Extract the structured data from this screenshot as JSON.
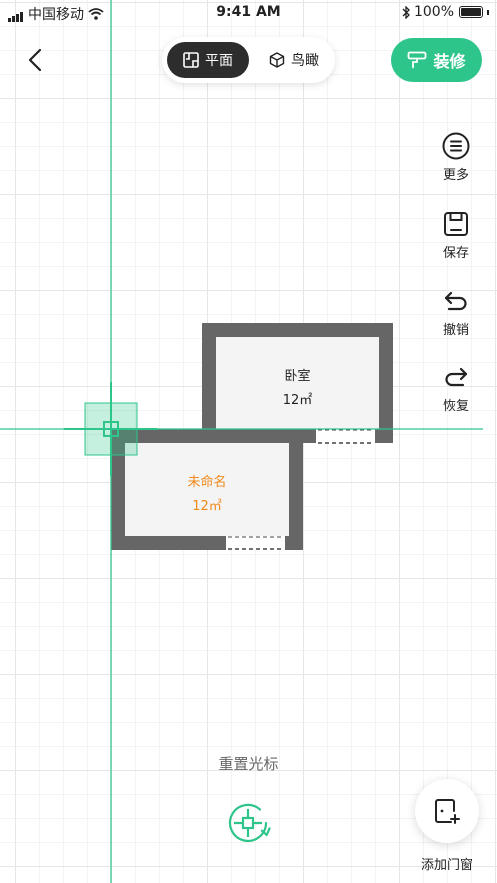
{
  "status_bar": {
    "carrier": "中国移动",
    "time": "9:41 AM",
    "battery": "100%"
  },
  "header": {
    "mode_plan_label": "平面",
    "mode_bird_label": "鸟瞰",
    "renovate_label": "装修",
    "active_mode": "平面"
  },
  "side_tools": {
    "more": "更多",
    "save": "保存",
    "undo": "撤销",
    "redo": "恢复"
  },
  "rooms": [
    {
      "name": "卧室",
      "area": "12㎡"
    },
    {
      "name": "未命名",
      "area": "12㎡"
    }
  ],
  "bottom": {
    "reset_cursor": "重置光标",
    "add_door_window": "添加门窗"
  },
  "colors": {
    "accent": "#2ec58b",
    "wall": "#666666",
    "floor": "#f4f4f4",
    "selected_room_text": "#f08a1c",
    "dark_chip": "#2d2d2d"
  },
  "icons": {
    "back": "chevron-left-icon",
    "plan": "floorplan-icon",
    "bird": "cube-icon",
    "renovate": "paint-roller-icon",
    "more": "menu-circle-icon",
    "save": "floppy-icon",
    "undo": "undo-icon",
    "redo": "redo-icon",
    "reset": "crosshair-reset-icon",
    "add_door": "door-add-icon"
  }
}
